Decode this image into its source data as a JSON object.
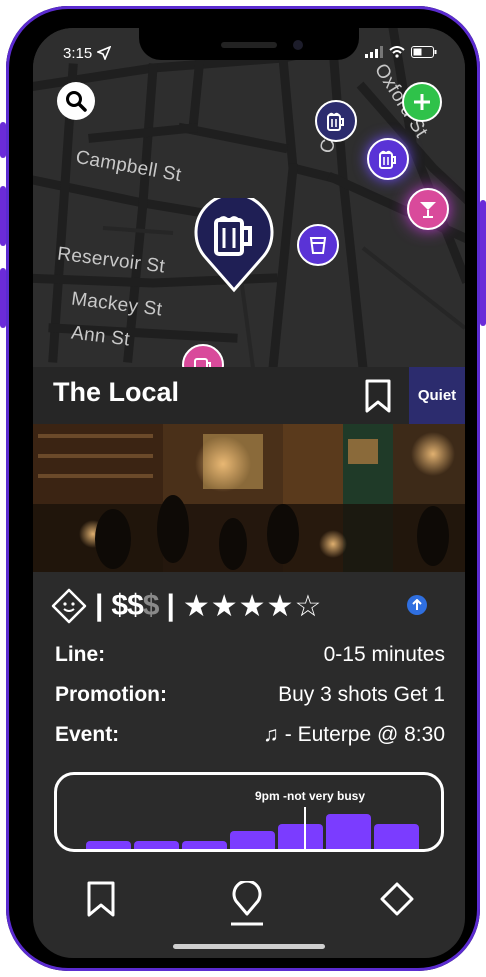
{
  "status_bar": {
    "time": "3:15"
  },
  "map": {
    "streets": [
      "Campbell St",
      "Reservoir St",
      "Mackey St",
      "Ann St",
      "Oxford St",
      "Cr"
    ],
    "pins": [
      {
        "icon": "beer-mug-icon",
        "color": "#2c2c6e"
      },
      {
        "icon": "beer-mug-icon",
        "color": "#5a33d6"
      },
      {
        "icon": "cocktail-icon",
        "color": "#d94a9b"
      },
      {
        "icon": "cup-icon",
        "color": "#5a33d6"
      },
      {
        "icon": "beer-mug-icon",
        "color": "#d94a9b"
      },
      {
        "icon": "beer-mug-icon",
        "color": "#1f1f55",
        "selected": true
      }
    ],
    "add_button_color": "#2fc24a"
  },
  "venue": {
    "name": "The Local",
    "badge": "Quiet",
    "price_active": "$$",
    "price_inactive": "$",
    "separator": "|",
    "stars": "★★★★☆",
    "rating_value": 4,
    "rating_max": 5
  },
  "info": [
    {
      "label": "Line:",
      "value": "0-15 minutes"
    },
    {
      "label": "Promotion:",
      "value": "Buy 3 shots Get 1"
    },
    {
      "label": "Event:",
      "value": "♫ - Euterpe @ 8:30"
    }
  ],
  "busyness": {
    "tooltip": "9pm -not very busy",
    "levels": [
      0.12,
      0.12,
      0.12,
      0.25,
      0.36,
      0.5,
      0.36
    ],
    "highlight_index": 4,
    "bar_color": "#7b3cff"
  },
  "nav": {
    "items": [
      {
        "icon": "bookmark-icon"
      },
      {
        "icon": "map-pin-icon",
        "active": true
      },
      {
        "icon": "diamond-icon"
      }
    ]
  },
  "colors": {
    "accent": "#7b3cff",
    "background": "#2b2b2b",
    "badge": "#2c2c6e"
  }
}
